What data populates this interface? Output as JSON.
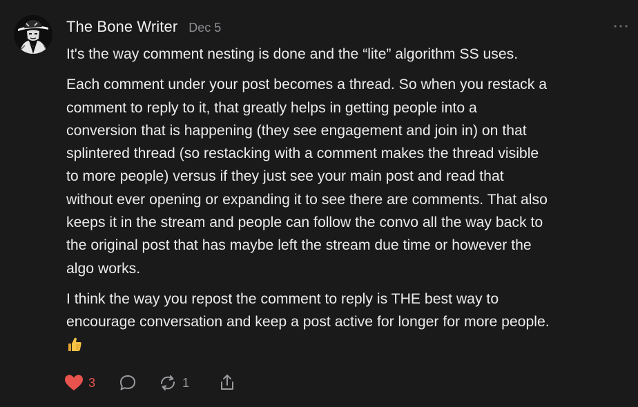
{
  "comment": {
    "author": "The Bone Writer",
    "date": "Dec 5",
    "paragraphs": [
      "It's the way comment nesting is done and the “lite” algorithm SS uses.",
      "Each comment under your post becomes a thread. So when you restack a\ncomment to reply to it, that greatly helps in getting people into a\nconversion that is happening (they see engagement and join in) on that\nsplintered thread (so restacking with a comment makes the thread visible\nto more people) versus if they just see your main post and read that\nwithout ever opening or expanding it to see there are comments. That also\nkeeps it in the stream and people can follow the convo all the way back to\nthe original post that has maybe left the stream due time or however the\nalgo works.",
      "I think the way you repost the comment to reply is THE best way to\nencourage conversation and keep a post active for longer for more people."
    ],
    "trailing_emoji": "thumbs-up"
  },
  "actions": {
    "like_count": "3",
    "restack_count": "1"
  },
  "icons": {
    "avatar": "avatar-figure",
    "more": "more-options-icon",
    "like": "heart-icon",
    "reply": "comment-bubble-icon",
    "restack": "restack-icon",
    "share": "share-icon"
  },
  "colors": {
    "background": "#1a1a1b",
    "text": "#ececec",
    "muted": "#8e8e93",
    "like": "#e8534d"
  }
}
